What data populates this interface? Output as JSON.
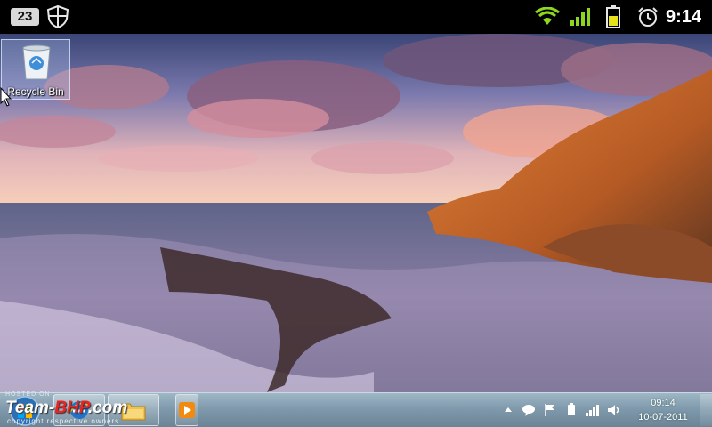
{
  "status_bar": {
    "notification_count": "23",
    "time": "9:14",
    "icons": [
      "shield-icon",
      "wifi-icon",
      "signal-icon",
      "battery-icon",
      "alarm-icon"
    ],
    "colors": {
      "background": "#000000",
      "signal": "#8fd61f"
    }
  },
  "desktop": {
    "icons": [
      {
        "label": "Recycle Bin",
        "icon": "recycle-bin-icon"
      }
    ]
  },
  "taskbar": {
    "pinned": [
      "internet-explorer-icon",
      "windows-explorer-icon",
      "media-player-icon"
    ],
    "tray_icons": [
      "show-hidden-icons-arrow",
      "messenger-icon",
      "action-center-flag-icon",
      "device-icon",
      "network-icon",
      "volume-icon"
    ],
    "clock": {
      "time": "09:14",
      "date": "10-07-2011"
    },
    "watermark": {
      "hosted": "HOSTED ON :",
      "brand_prefix": "Team-",
      "brand_accent": "BHP",
      "brand_suffix": ".com",
      "copyright": "copyright respective owners"
    }
  }
}
